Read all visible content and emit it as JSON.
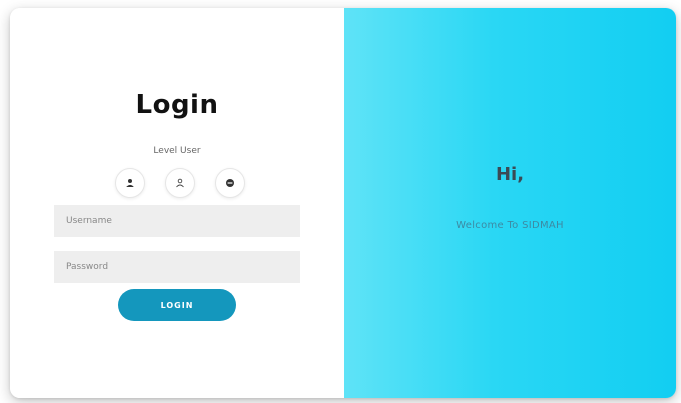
{
  "login_panel": {
    "title": "Login",
    "level_label": "Level User",
    "roles": [
      {
        "icon": "user-solid-icon"
      },
      {
        "icon": "user-outline-icon"
      },
      {
        "icon": "minus-circle-icon"
      }
    ],
    "username_placeholder": "Username",
    "password_placeholder": "Password",
    "login_button": "LOGIN"
  },
  "welcome_panel": {
    "greeting": "Hi,",
    "message": "Welcome To SIDMAH"
  },
  "colors": {
    "accent_button": "#1497bd",
    "panel_gradient_start": "#5fe3f7",
    "panel_gradient_end": "#12cef2",
    "input_background": "#eeeeee"
  }
}
